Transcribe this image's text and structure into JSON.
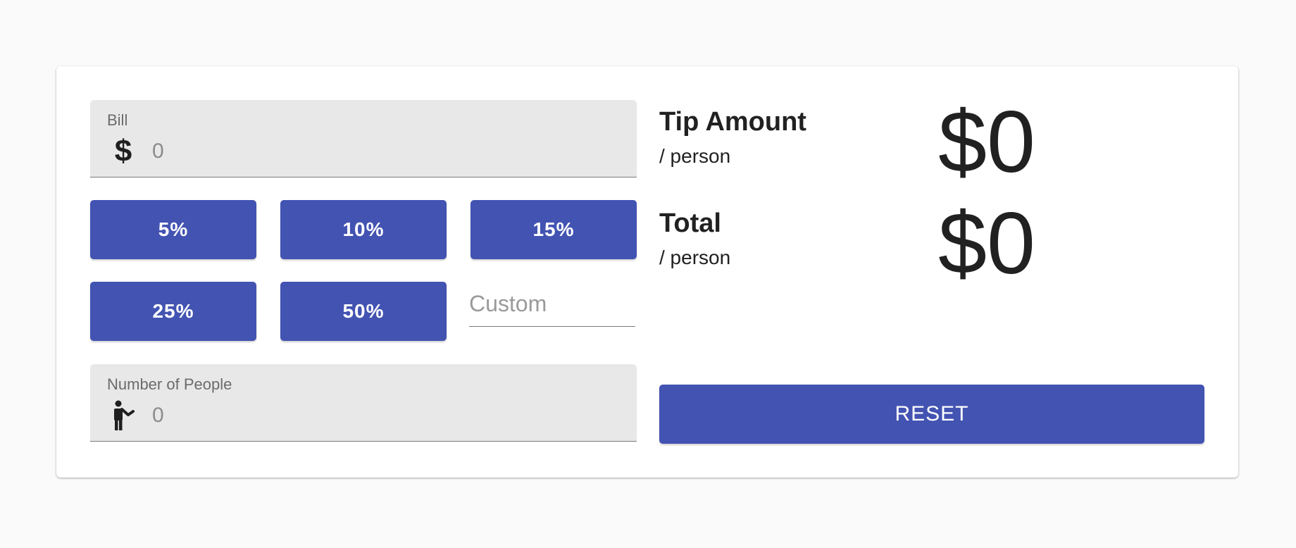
{
  "colors": {
    "page_background": "#fafafa",
    "card_background": "#ffffff",
    "primary": "#4353b2",
    "field_background": "#e8e8e8",
    "text": "#212121",
    "label_text": "#6b6b6b"
  },
  "bill": {
    "label": "Bill",
    "icon": "dollar-sign-icon",
    "value": "",
    "placeholder": "0"
  },
  "tips": {
    "options": [
      "5%",
      "10%",
      "15%",
      "25%",
      "50%"
    ],
    "custom_placeholder": "Custom",
    "custom_value": ""
  },
  "people": {
    "label": "Number of People",
    "icon": "person-waving-icon",
    "value": "",
    "placeholder": "0"
  },
  "results": {
    "tip_amount": {
      "title": "Tip Amount",
      "subtitle": "/ person",
      "value": "$0"
    },
    "total": {
      "title": "Total",
      "subtitle": "/ person",
      "value": "$0"
    }
  },
  "reset_label": "RESET"
}
